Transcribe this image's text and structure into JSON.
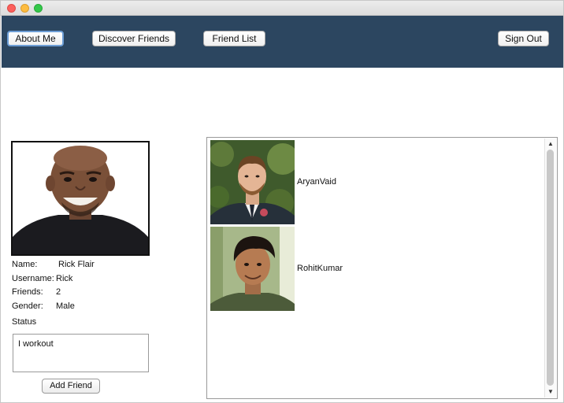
{
  "window": {
    "controls": [
      "close",
      "minimize",
      "zoom"
    ]
  },
  "nav": {
    "about_me": "About Me",
    "discover_friends": "Discover Friends",
    "friend_list": "Friend List",
    "sign_out": "Sign Out"
  },
  "profile": {
    "name_label": "Name:",
    "name_value": "Rick Flair",
    "username_label": "Username:",
    "username_value": "Rick",
    "friends_label": "Friends:",
    "friends_value": "2",
    "gender_label": "Gender:",
    "gender_value": "Male",
    "status_label": "Status",
    "status_text": "I workout",
    "add_friend": "Add Friend"
  },
  "friends": [
    {
      "name": "AryanVaid"
    },
    {
      "name": "RohitKumar"
    }
  ],
  "colors": {
    "navbar": "#2c4660",
    "active_button_border": "#6d9ed6"
  }
}
